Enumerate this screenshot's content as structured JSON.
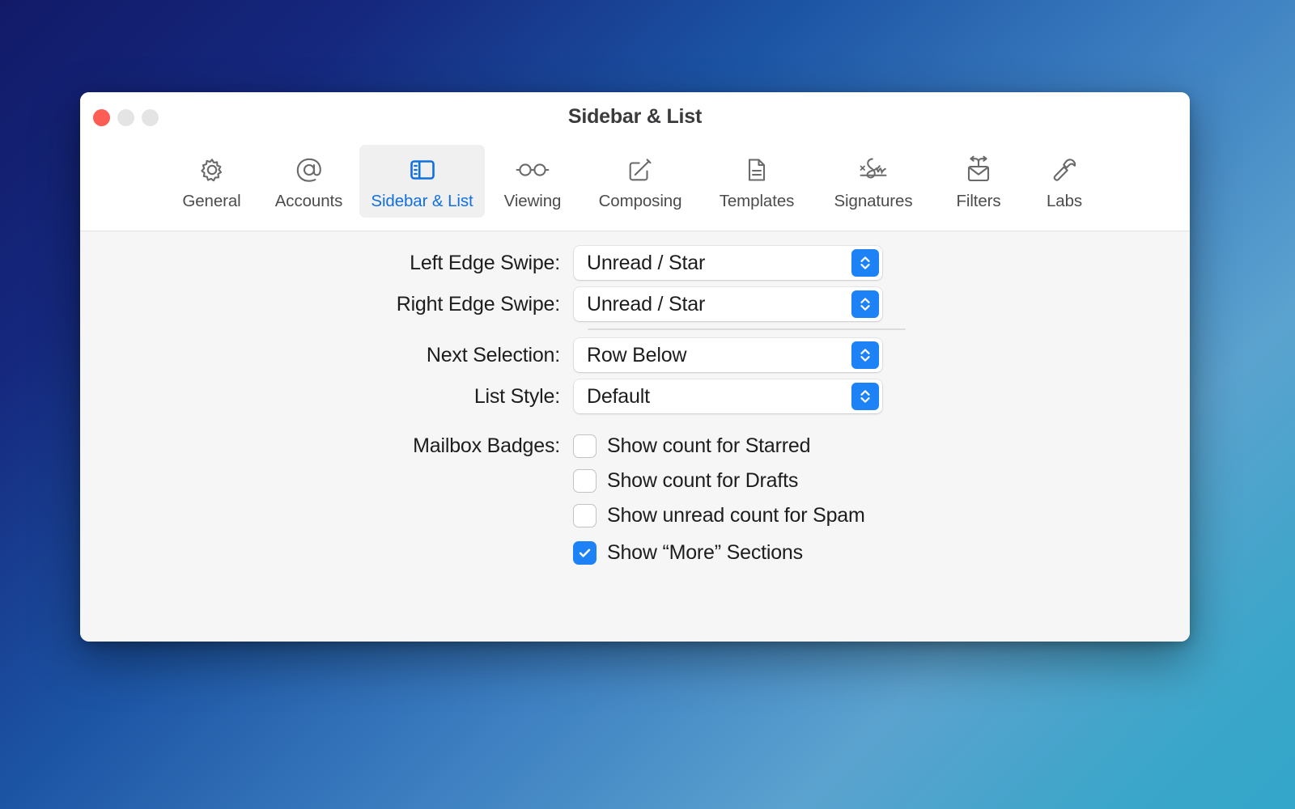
{
  "window": {
    "title": "Sidebar & List",
    "traffic_lights": [
      {
        "name": "close",
        "color": "#fc5d54"
      },
      {
        "name": "minimize",
        "color": "#e4e4e4"
      },
      {
        "name": "zoom",
        "color": "#e4e4e4"
      }
    ]
  },
  "toolbar": {
    "tabs": [
      {
        "label": "General",
        "icon": "gear-icon",
        "active": false
      },
      {
        "label": "Accounts",
        "icon": "at-sign-icon",
        "active": false
      },
      {
        "label": "Sidebar & List",
        "icon": "sidebar-icon",
        "active": true
      },
      {
        "label": "Viewing",
        "icon": "glasses-icon",
        "active": false
      },
      {
        "label": "Composing",
        "icon": "compose-icon",
        "active": false
      },
      {
        "label": "Templates",
        "icon": "document-icon",
        "active": false
      },
      {
        "label": "Signatures",
        "icon": "signature-icon",
        "active": false
      },
      {
        "label": "Filters",
        "icon": "envelope-arrows-icon",
        "active": false
      },
      {
        "label": "Labs",
        "icon": "hammer-icon",
        "active": false
      }
    ]
  },
  "settings": {
    "left_edge_swipe": {
      "label": "Left Edge Swipe:",
      "value": "Unread / Star"
    },
    "right_edge_swipe": {
      "label": "Right Edge Swipe:",
      "value": "Unread / Star"
    },
    "next_selection": {
      "label": "Next Selection:",
      "value": "Row Below"
    },
    "list_style": {
      "label": "List Style:",
      "value": "Default"
    },
    "mailbox_badges": {
      "label": "Mailbox Badges:",
      "options": [
        {
          "label": "Show count for Starred",
          "checked": false
        },
        {
          "label": "Show count for Drafts",
          "checked": false
        },
        {
          "label": "Show unread count for Spam",
          "checked": false
        }
      ]
    },
    "show_more_sections": {
      "label": "Show “More” Sections",
      "checked": true
    }
  },
  "annotation": {
    "highlight_color": "#ed1f2e",
    "target": "mailbox-badges-group"
  },
  "colors": {
    "accent": "#1d82f5",
    "active_tab_text": "#1170e0",
    "pane_background": "#f6f6f6",
    "window_background": "#ffffff"
  }
}
